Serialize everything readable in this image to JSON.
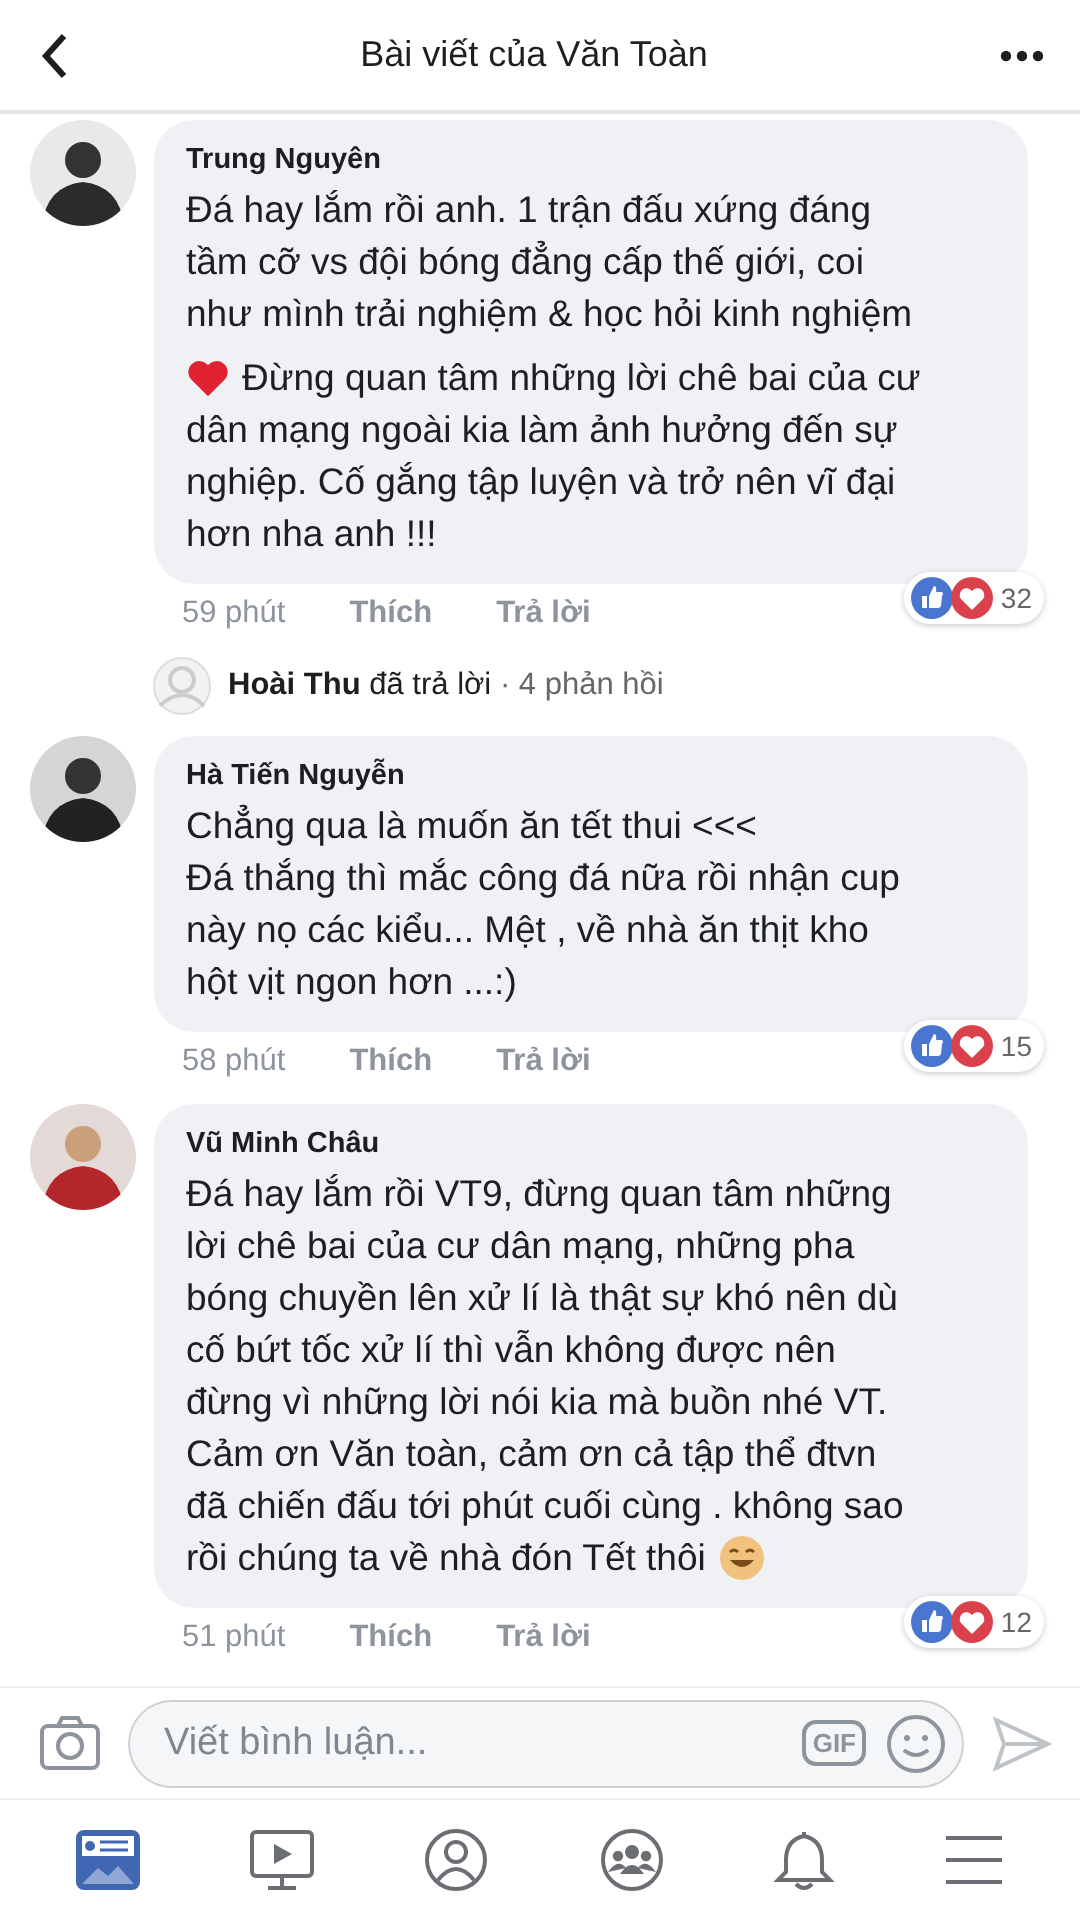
{
  "header": {
    "title": "Bài viết của Văn Toàn"
  },
  "comments": [
    {
      "author": "Trung Nguyên",
      "lines": [
        {
          "text": "Đá hay lắm rồi anh. 1 trận đấu xứng đáng"
        },
        {
          "text": "tầm cỡ vs đội bóng đẳng cấp thế giới, coi"
        },
        {
          "text": "như mình trải nghiệm & học hỏi kinh nghiệm"
        },
        {
          "text": "Đừng quan tâm những lời chê bai của cư",
          "heart_emoji": true
        },
        {
          "text": "dân mạng ngoài kia làm ảnh hưởng đến sự"
        },
        {
          "text": "nghiệp. Cố gắng tập luyện và trở nên vĩ đại"
        },
        {
          "text": "hơn nha anh !!!"
        }
      ],
      "time": "59 phút",
      "like": "Thích",
      "reply": "Trả lời",
      "reactions": "32",
      "replies": {
        "name": "Hoài Thu",
        "action": "đã trả lời",
        "count": "· 4 phản hồi"
      }
    },
    {
      "author": "Hà Tiến Nguyễn",
      "lines": [
        {
          "text": "Chẳng qua là muốn ăn tết thui <<<"
        },
        {
          "text": "Đá thắng thì mắc công đá nữa rồi nhận cup"
        },
        {
          "text": "này nọ các kiểu... Mệt , về nhà ăn thịt kho"
        },
        {
          "text": "hột vịt ngon hơn ...:)"
        }
      ],
      "time": "58 phút",
      "like": "Thích",
      "reply": "Trả lời",
      "reactions": "15"
    },
    {
      "author": "Vũ Minh Châu",
      "lines": [
        {
          "text": "Đá hay lắm rồi VT9, đừng quan tâm những"
        },
        {
          "text": "lời chê bai của cư dân mạng, những pha"
        },
        {
          "text": "bóng chuyền lên xử lí là thật sự khó nên dù"
        },
        {
          "text": "cố bứt tốc xử lí thì vẫn không được nên"
        },
        {
          "text": "đừng vì những lời nói kia mà buồn nhé VT."
        },
        {
          "text": "Cảm ơn Văn toàn, cảm ơn cả tập thể đtvn"
        },
        {
          "text": "đã chiến đấu tới phút cuối cùng . không sao"
        },
        {
          "text": "rồi chúng ta về nhà đón Tết thôi",
          "smiley_emoji": true
        }
      ],
      "time": "51 phút",
      "like": "Thích",
      "reply": "Trả lời",
      "reactions": "12"
    }
  ],
  "composer": {
    "placeholder": "Viết bình luận...",
    "gif": "GIF"
  },
  "tabs": [
    {
      "kind": "feed",
      "selected": true
    },
    {
      "kind": "video",
      "selected": false
    },
    {
      "kind": "profile",
      "selected": false
    },
    {
      "kind": "groups",
      "selected": false
    },
    {
      "kind": "bell",
      "selected": false
    },
    {
      "kind": "menu",
      "selected": false
    }
  ]
}
